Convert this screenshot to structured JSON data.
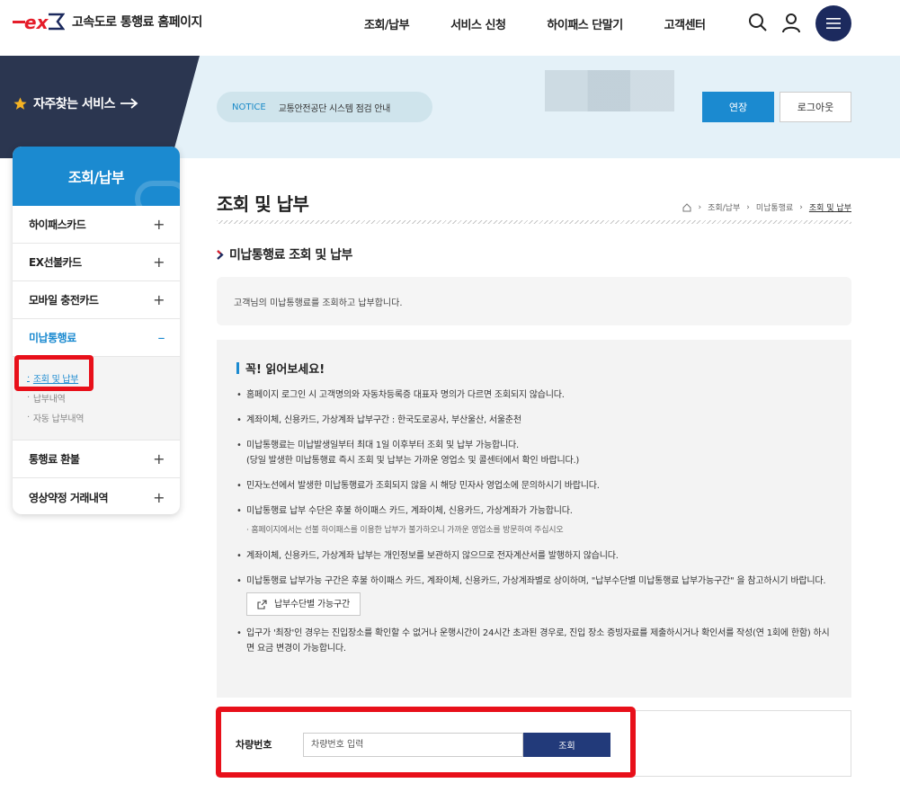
{
  "header": {
    "logo_text": "고속도로 통행료 홈페이지",
    "nav": [
      "조회/납부",
      "서비스 신청",
      "하이패스 단말기",
      "고객센터"
    ]
  },
  "banner": {
    "fav_label": "자주찾는 서비스",
    "notice_tag": "NOTICE",
    "notice_text": "교통안전공단 시스템 점검 안내",
    "extend_label": "연장",
    "logout_label": "로그아웃"
  },
  "sidebar": {
    "title": "조회/납부",
    "items": [
      {
        "label": "하이패스카드",
        "toggle": "+"
      },
      {
        "label": "EX선불카드",
        "toggle": "+"
      },
      {
        "label": "모바일 충전카드",
        "toggle": "+"
      },
      {
        "label": "미납통행료",
        "toggle": "–"
      },
      {
        "label": "통행료 환불",
        "toggle": "+"
      },
      {
        "label": "영상약정 거래내역",
        "toggle": "+"
      }
    ],
    "sub_items": [
      "조회 및 납부",
      "납부내역",
      "자동 납부내역"
    ]
  },
  "main": {
    "page_title": "조회 및 납부",
    "breadcrumb": [
      "조회/납부",
      "미납통행료",
      "조회 및 납부"
    ],
    "section_title": "미납통행료 조회 및 납부",
    "intro": "고객님의 미납통행료를 조회하고 납부합니다.",
    "read_title": "꼭! 읽어보세요!",
    "notes": [
      "홈페이지 로그인 시 고객명의와 자동차등록증 대표자 명의가 다르면 조회되지 않습니다.",
      "계좌이체, 신용카드, 가상계좌 납부구간 : 한국도로공사, 부산울산, 서울춘천",
      "미납통행료는 미납발생일부터 최대 1일 이후부터 조회 및 납부 가능합니다.",
      "(당일 발생한 미납통행료 즉시 조회 및 납부는 가까운 영업소 및 콜센터에서 확인 바랍니다.)",
      "민자노선에서 발생한 미납통행료가 조회되지 않을 시 해당 민자사 영업소에 문의하시기 바랍니다.",
      "미납통행료 납부 수단은 후불 하이패스 카드, 계좌이체, 신용카드, 가상계좌가 가능합니다.",
      "· 홈페이지에서는 선불 하이패스를 이용한 납부가 불가하오니 가까운 영업소를 방문하여 주십시오",
      "계좌이체, 신용카드, 가상계좌 납부는 개인정보를 보관하지 않으므로 전자계산서를 발행하지 않습니다.",
      "미납통행료 납부가능 구간은 후불 하이패스 카드, 계좌이체, 신용카드, 가상계좌별로 상이하며, \"납부수단별 미납통행료 납부가능구간\" 을 참고하시기 바랍니다.",
      "입구가 '최장'인 경우는 진입장소를 확인할 수 없거나 운행시간이 24시간 초과된 경우로, 진입 장소 증빙자료를 제출하시거나 확인서를 작성(연 1회에 한함) 하시면 요금 변경이 가능합니다."
    ],
    "link_button": "납부수단별 가능구간",
    "car_label": "차량번호",
    "car_placeholder": "차량번호 입력",
    "search_label": "조회"
  },
  "colors": {
    "brand_blue": "#1b8ad0",
    "navy": "#1c2a5e",
    "highlight_red": "#e8101a",
    "logo_red": "#e51d2a"
  }
}
